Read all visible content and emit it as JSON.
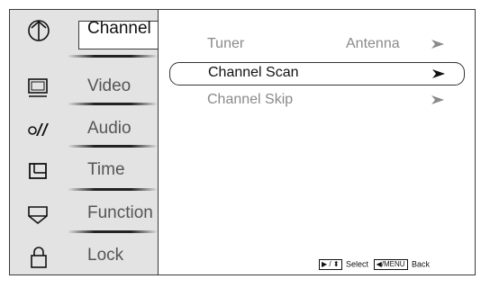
{
  "sidebar": {
    "items": [
      {
        "label": "Channel",
        "icon": "antenna-icon"
      },
      {
        "label": "Video",
        "icon": "monitor-icon"
      },
      {
        "label": "Audio",
        "icon": "audio-icon"
      },
      {
        "label": "Time",
        "icon": "clock-icon"
      },
      {
        "label": "Function",
        "icon": "function-icon"
      },
      {
        "label": "Lock",
        "icon": "lock-icon"
      }
    ],
    "active_index": 0
  },
  "content": {
    "rows": [
      {
        "label": "Tuner",
        "value": "Antenna"
      },
      {
        "label": "Channel Scan",
        "value": ""
      },
      {
        "label": "Channel Skip",
        "value": ""
      }
    ],
    "selected_index": 1
  },
  "hint": {
    "select_keys": "▶ / ⬍",
    "select_label": "Select",
    "back_key": "◀/MENU",
    "back_label": "Back"
  }
}
